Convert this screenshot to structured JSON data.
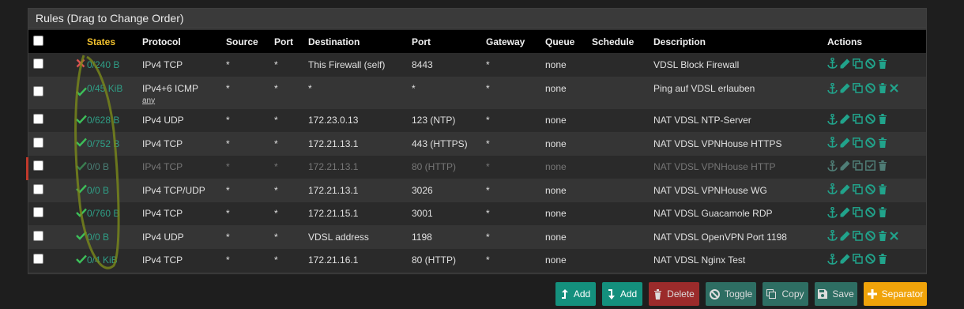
{
  "panel": {
    "title": "Rules (Drag to Change Order)"
  },
  "columns": [
    "States",
    "Protocol",
    "Source",
    "Port",
    "Destination",
    "Port",
    "Gateway",
    "Queue",
    "Schedule",
    "Description",
    "Actions"
  ],
  "rows": [
    {
      "status": "block",
      "states": "0/240 B",
      "protocol": "IPv4 TCP",
      "protocol_sub": "",
      "source": "*",
      "sport": "*",
      "destination": "This Firewall (self)",
      "dport": "8443",
      "gateway": "*",
      "queue": "none",
      "schedule": "",
      "description": "VDSL Block Firewall",
      "extra_delete": false
    },
    {
      "status": "pass",
      "states": "0/45 KiB",
      "protocol": "IPv4+6 ICMP",
      "protocol_sub": "any",
      "source": "*",
      "sport": "*",
      "destination": "*",
      "dport": "*",
      "gateway": "*",
      "queue": "none",
      "schedule": "",
      "description": "Ping auf VDSL erlauben",
      "extra_delete": true
    },
    {
      "status": "pass",
      "states": "0/628 B",
      "protocol": "IPv4 UDP",
      "protocol_sub": "",
      "source": "*",
      "sport": "*",
      "destination": "172.23.0.13",
      "dport": "123 (NTP)",
      "gateway": "*",
      "queue": "none",
      "schedule": "",
      "description": "NAT VDSL NTP-Server",
      "extra_delete": false
    },
    {
      "status": "pass",
      "states": "0/752 B",
      "protocol": "IPv4 TCP",
      "protocol_sub": "",
      "source": "*",
      "sport": "*",
      "destination": "172.21.13.1",
      "dport": "443 (HTTPS)",
      "gateway": "*",
      "queue": "none",
      "schedule": "",
      "description": "NAT VDSL VPNHouse HTTPS",
      "extra_delete": false
    },
    {
      "status": "pass",
      "states": "0/0 B",
      "protocol": "IPv4 TCP",
      "protocol_sub": "",
      "source": "*",
      "sport": "*",
      "destination": "172.21.13.1",
      "dport": "80 (HTTP)",
      "gateway": "*",
      "queue": "none",
      "schedule": "",
      "description": "NAT VDSL VPNHouse HTTP",
      "extra_delete": false,
      "disabled": true
    },
    {
      "status": "pass",
      "states": "0/0 B",
      "protocol": "IPv4 TCP/UDP",
      "protocol_sub": "",
      "source": "*",
      "sport": "*",
      "destination": "172.21.13.1",
      "dport": "3026",
      "gateway": "*",
      "queue": "none",
      "schedule": "",
      "description": "NAT VDSL VPNHouse WG",
      "extra_delete": false
    },
    {
      "status": "pass",
      "states": "0/760 B",
      "protocol": "IPv4 TCP",
      "protocol_sub": "",
      "source": "*",
      "sport": "*",
      "destination": "172.21.15.1",
      "dport": "3001",
      "gateway": "*",
      "queue": "none",
      "schedule": "",
      "description": "NAT VDSL Guacamole RDP",
      "extra_delete": false
    },
    {
      "status": "pass",
      "states": "0/0 B",
      "protocol": "IPv4 UDP",
      "protocol_sub": "",
      "source": "*",
      "sport": "*",
      "destination": "VDSL address",
      "dport": "1198",
      "gateway": "*",
      "queue": "none",
      "schedule": "",
      "description": "NAT VDSL OpenVPN Port 1198",
      "extra_delete": true
    },
    {
      "status": "pass",
      "states": "0/4 KiB",
      "protocol": "IPv4 TCP",
      "protocol_sub": "",
      "source": "*",
      "sport": "*",
      "destination": "172.21.16.1",
      "dport": "80 (HTTP)",
      "gateway": "*",
      "queue": "none",
      "schedule": "",
      "description": "NAT VDSL Nginx Test",
      "extra_delete": false
    }
  ],
  "buttons": {
    "add_top": "Add",
    "add_bottom": "Add",
    "delete": "Delete",
    "toggle": "Toggle",
    "copy": "Copy",
    "save": "Save",
    "separator": "Separator"
  },
  "colors": {
    "accent": "#21a38b",
    "add": "#14907d",
    "delete": "#9b2b2b",
    "toggle": "#2e6e63",
    "save": "#2e6e63",
    "separator": "#f0a30a",
    "block": "#d9534f",
    "pass": "#3dbf5a"
  }
}
